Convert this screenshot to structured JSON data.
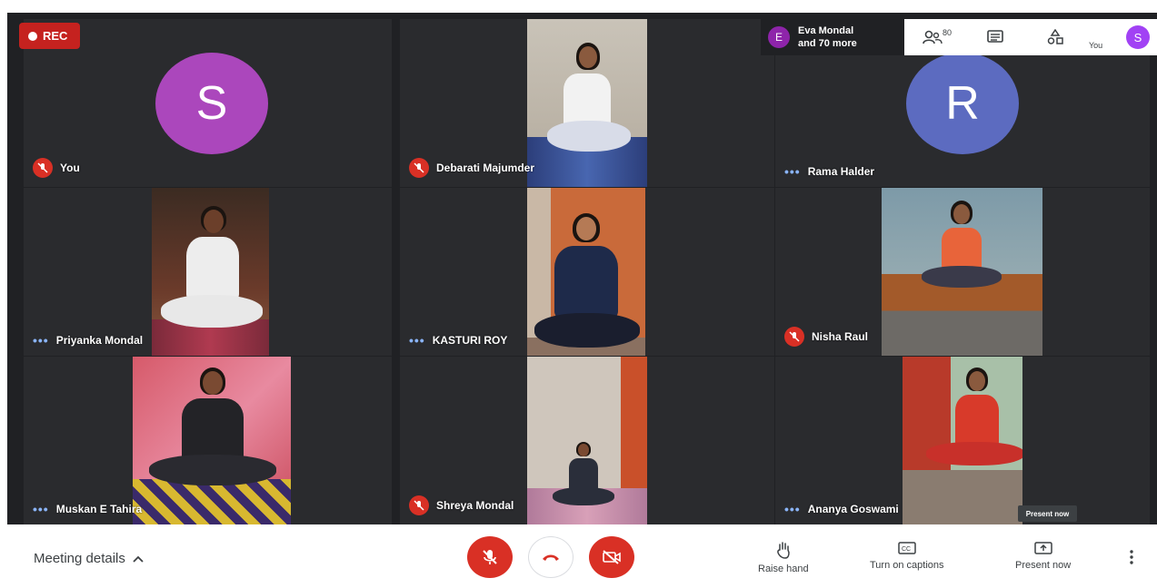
{
  "recording": {
    "label": "REC"
  },
  "topbar": {
    "participants_avatar_letter": "E",
    "participants_line1": "Eva Mondal",
    "participants_line2": "and 70 more",
    "people_count": "80",
    "you_label": "You",
    "you_avatar_letter": "S"
  },
  "tiles": [
    {
      "name": "You",
      "status": "muted",
      "avatar_letter": "S",
      "avatar_color": "#ab47bc"
    },
    {
      "name": "Debarati Majumder",
      "status": "muted"
    },
    {
      "name": "Rama Halder",
      "status": "speaking",
      "avatar_letter": "R",
      "avatar_color": "#5c6bc0"
    },
    {
      "name": "Priyanka Mondal",
      "status": "speaking"
    },
    {
      "name": "KASTURI ROY",
      "status": "speaking"
    },
    {
      "name": "Nisha Raul",
      "status": "muted"
    },
    {
      "name": "Muskan E Tahira",
      "status": "speaking"
    },
    {
      "name": "Shreya Mondal",
      "status": "muted"
    },
    {
      "name": "Ananya Goswami",
      "status": "speaking"
    }
  ],
  "tooltip": {
    "present_now": "Present now"
  },
  "bottombar": {
    "meeting_details": "Meeting details",
    "raise_hand": "Raise hand",
    "captions": "Turn on captions",
    "present": "Present now"
  },
  "colors": {
    "mute_red": "#d93025",
    "rec_red": "#c5221f",
    "tile_bg": "#2a2b2e",
    "stage_bg": "#202124",
    "dots_blue": "#8ab4f8"
  }
}
